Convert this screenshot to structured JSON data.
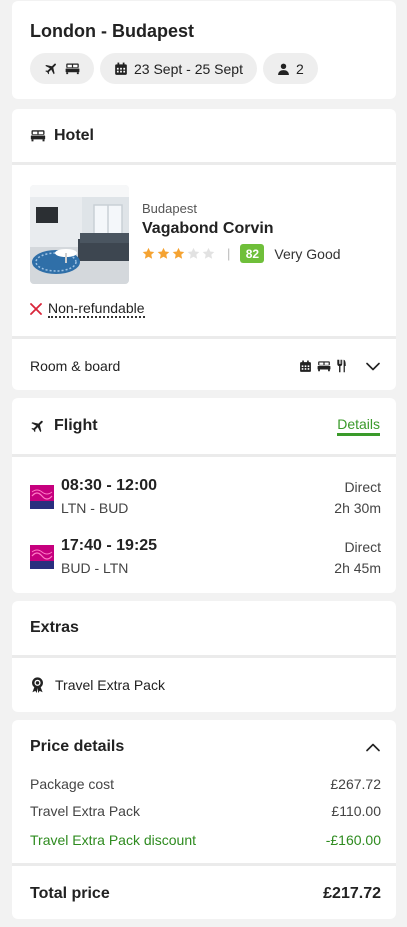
{
  "trip": {
    "title": "London - Budapest",
    "dates": "23 Sept - 25 Sept",
    "travellers": "2",
    "chip_icons": [
      "plane-icon",
      "bed-icon",
      "calendar-icon",
      "person-icon"
    ]
  },
  "hotel": {
    "section_title": "Hotel",
    "city": "Budapest",
    "name": "Vagabond Corvin",
    "stars": 3,
    "stars_max": 5,
    "rating_sep": "|",
    "score": "82",
    "score_label": "Very Good",
    "refund_label": "Non-refundable",
    "board_label": "Room & board"
  },
  "flight": {
    "section_title": "Flight",
    "details_link": "Details",
    "legs": [
      {
        "times": "08:30 - 12:00",
        "route": "LTN  - BUD",
        "stops": "Direct",
        "duration": "2h 30m"
      },
      {
        "times": "17:40 - 19:25",
        "route": "BUD  - LTN",
        "stops": "Direct",
        "duration": "2h 45m"
      }
    ]
  },
  "extras": {
    "section_title": "Extras",
    "item": "Travel Extra Pack"
  },
  "price": {
    "section_title": "Price details",
    "lines": [
      {
        "label": "Package cost",
        "amount": "£267.72"
      },
      {
        "label": "Travel Extra Pack",
        "amount": "£110.00"
      }
    ],
    "discount": {
      "label": "Travel Extra Pack discount",
      "amount": "-£160.00"
    },
    "total_label": "Total price",
    "total_amount": "£217.72"
  },
  "colors": {
    "accent_green": "#3a9a2a",
    "star_orange": "#f5a332",
    "score_green": "#6fbf3a",
    "error_red": "#d9253a"
  }
}
